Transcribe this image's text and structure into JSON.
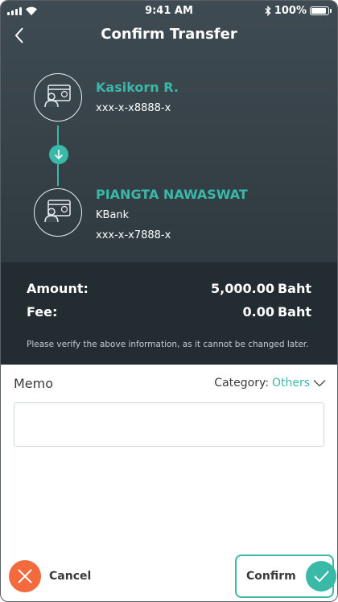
{
  "status_bar": {
    "time": "9:41 AM",
    "battery": "100%",
    "battery_level": 1.0
  },
  "header": {
    "title": "Confirm Transfer"
  },
  "sender": {
    "name": "Kasikorn R.",
    "account": "xxx-x-x8888-x"
  },
  "receiver": {
    "name": "PIANGTA NAWASWAT",
    "bank": "KBank",
    "account": "xxx-x-x7888-x"
  },
  "summary": {
    "amount_label": "Amount:",
    "amount_value": "5,000.00",
    "amount_currency": "Baht",
    "fee_label": "Fee:",
    "fee_value": "0.00",
    "fee_currency": "Baht",
    "note": "Please verify the above information, as it cannot be changed later."
  },
  "memo": {
    "label": "Memo",
    "value": "",
    "category_label": "Category:",
    "category_value": "Others"
  },
  "actions": {
    "cancel_label": "Cancel",
    "confirm_label": "Confirm"
  },
  "colors": {
    "accent": "#3ab8a8",
    "cancel": "#f26a3d",
    "header_bg": "#3f4b52",
    "summary_bg": "#232c31"
  }
}
